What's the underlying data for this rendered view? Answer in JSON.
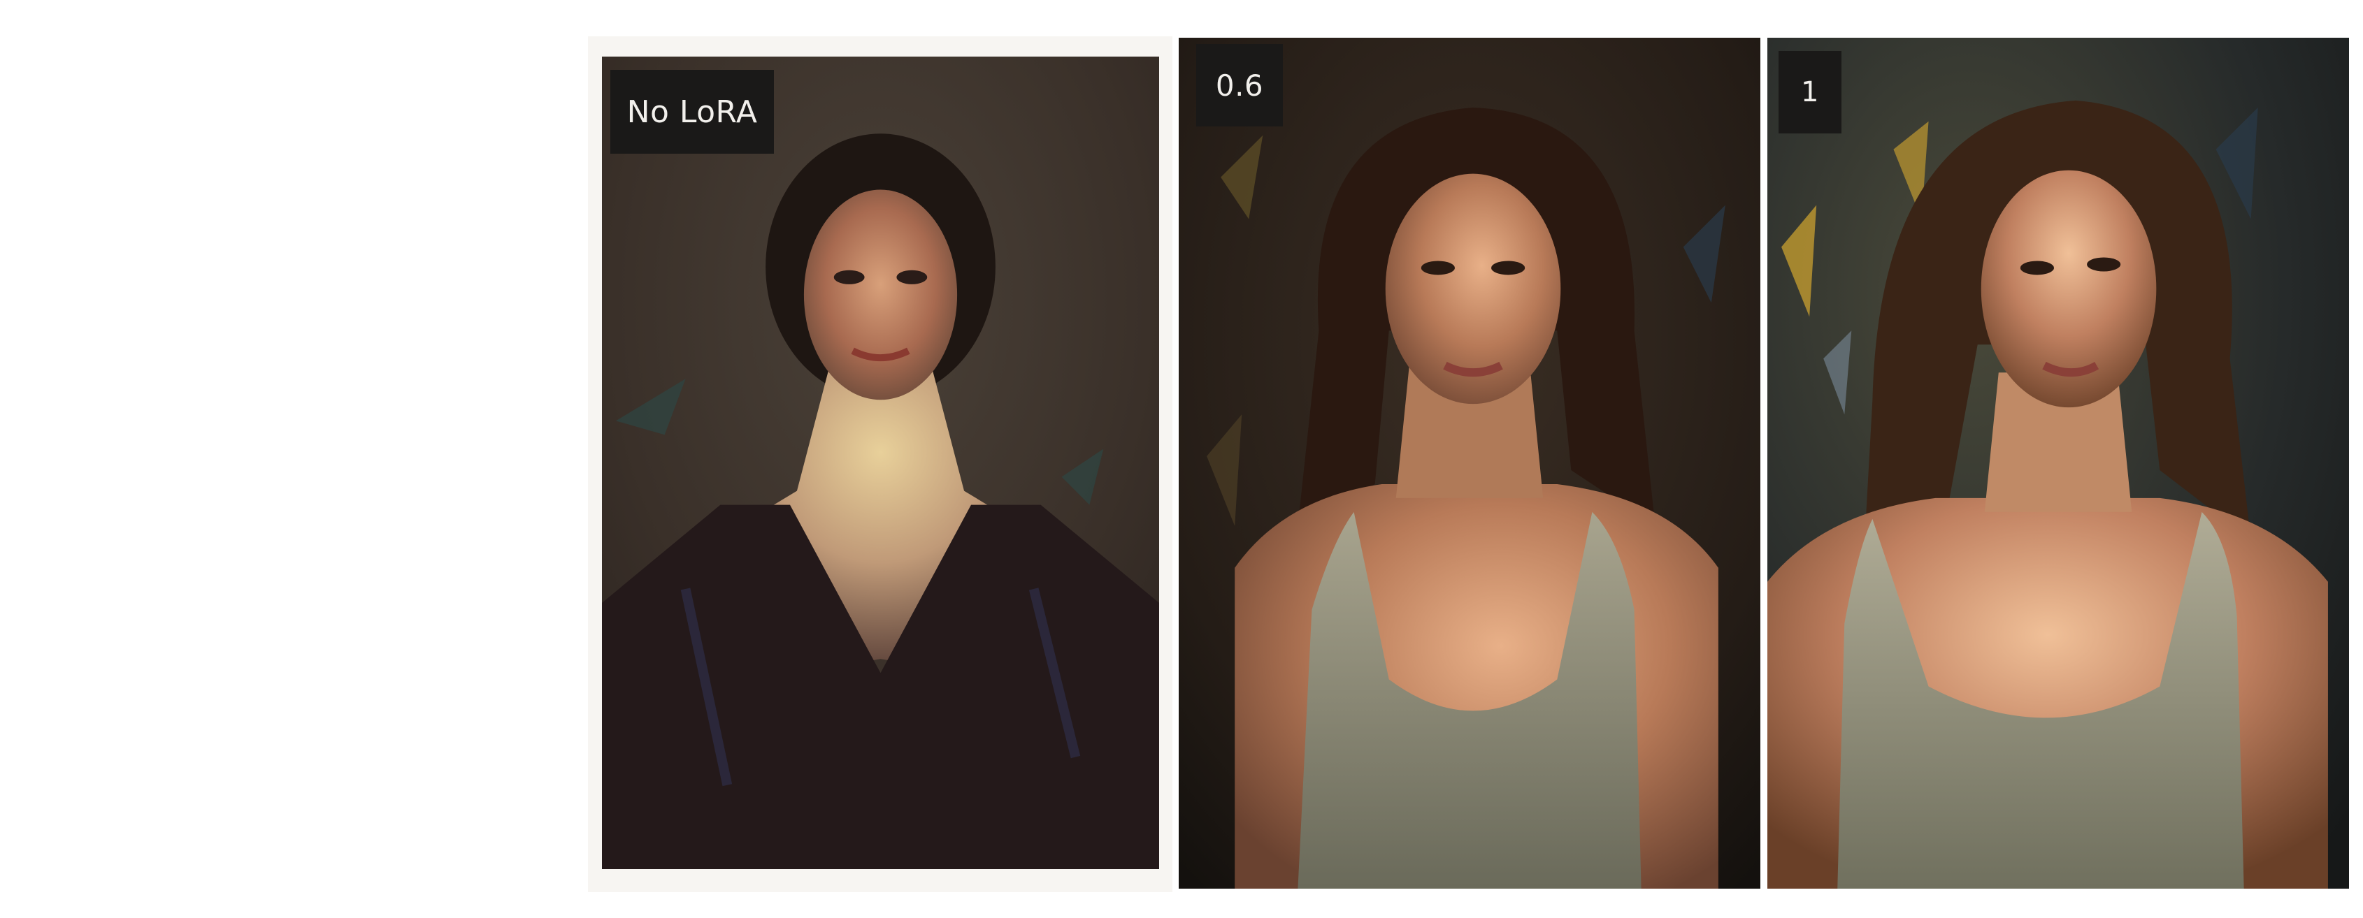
{
  "comparison": {
    "panels": [
      {
        "label": "No LoRA",
        "image": "oil-portrait-woman-dark-dress"
      },
      {
        "label": "0.6",
        "image": "oil-portrait-woman-tank-top"
      },
      {
        "label": "1",
        "image": "oil-portrait-woman-tank-top-sunlit"
      }
    ]
  },
  "colors": {
    "page_background": "#ffffff",
    "label_background": "#1a1918",
    "label_text": "#f2f0ec"
  }
}
